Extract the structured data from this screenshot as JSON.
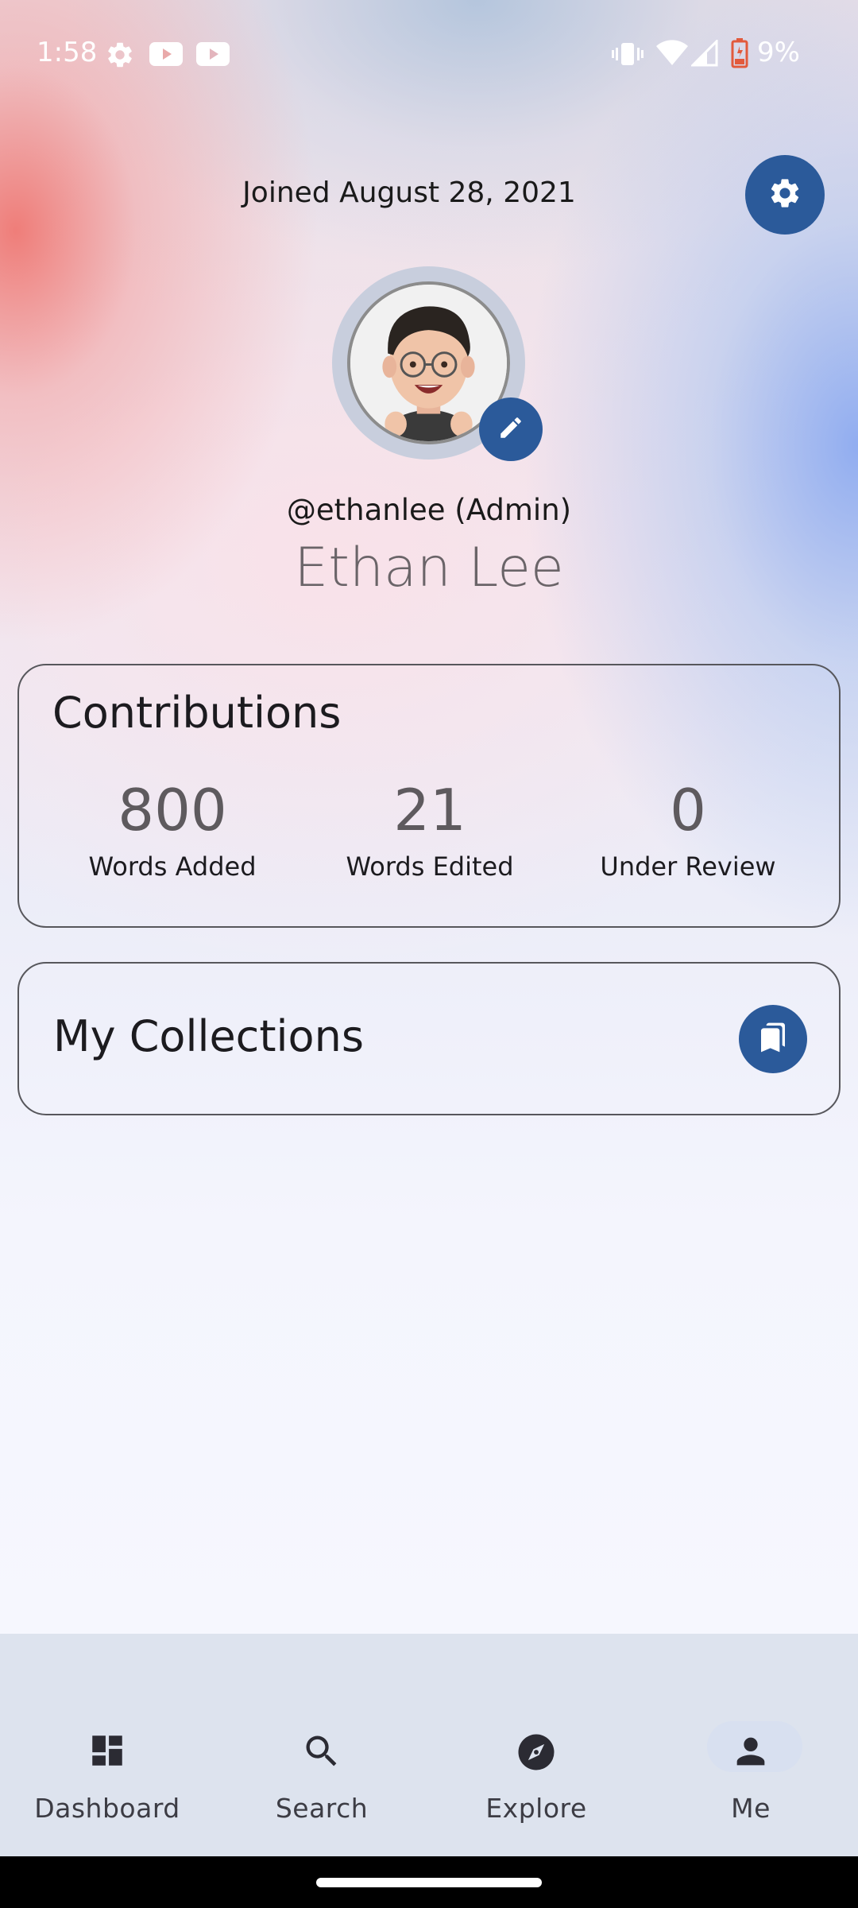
{
  "status_bar": {
    "time": "1:58",
    "battery_percent": "9%",
    "icons": [
      "settings-gear-icon",
      "youtube-icon",
      "youtube-icon",
      "vibrate-icon",
      "wifi-icon",
      "signal-icon",
      "battery-low-icon"
    ]
  },
  "profile": {
    "joined": "Joined August 28, 2021",
    "username": "@ethanlee (Admin)",
    "full_name": "Ethan Lee",
    "avatar_icon": "memoji-avatar",
    "edit_icon": "pencil-icon",
    "settings_icon": "gear-icon"
  },
  "contributions": {
    "title": "Contributions",
    "stats": [
      {
        "value": "800",
        "label": "Words Added"
      },
      {
        "value": "21",
        "label": "Words Edited"
      },
      {
        "value": "0",
        "label": "Under Review"
      }
    ]
  },
  "collections": {
    "title": "My Collections",
    "icon": "bookmarks-icon"
  },
  "nav": {
    "items": [
      {
        "label": "Dashboard",
        "icon": "dashboard-icon"
      },
      {
        "label": "Search",
        "icon": "search-icon"
      },
      {
        "label": "Explore",
        "icon": "compass-icon"
      },
      {
        "label": "Me",
        "icon": "person-icon",
        "selected": true
      }
    ]
  },
  "colors": {
    "accent": "#2b5a9a",
    "nav_background": "#dde3ee"
  }
}
